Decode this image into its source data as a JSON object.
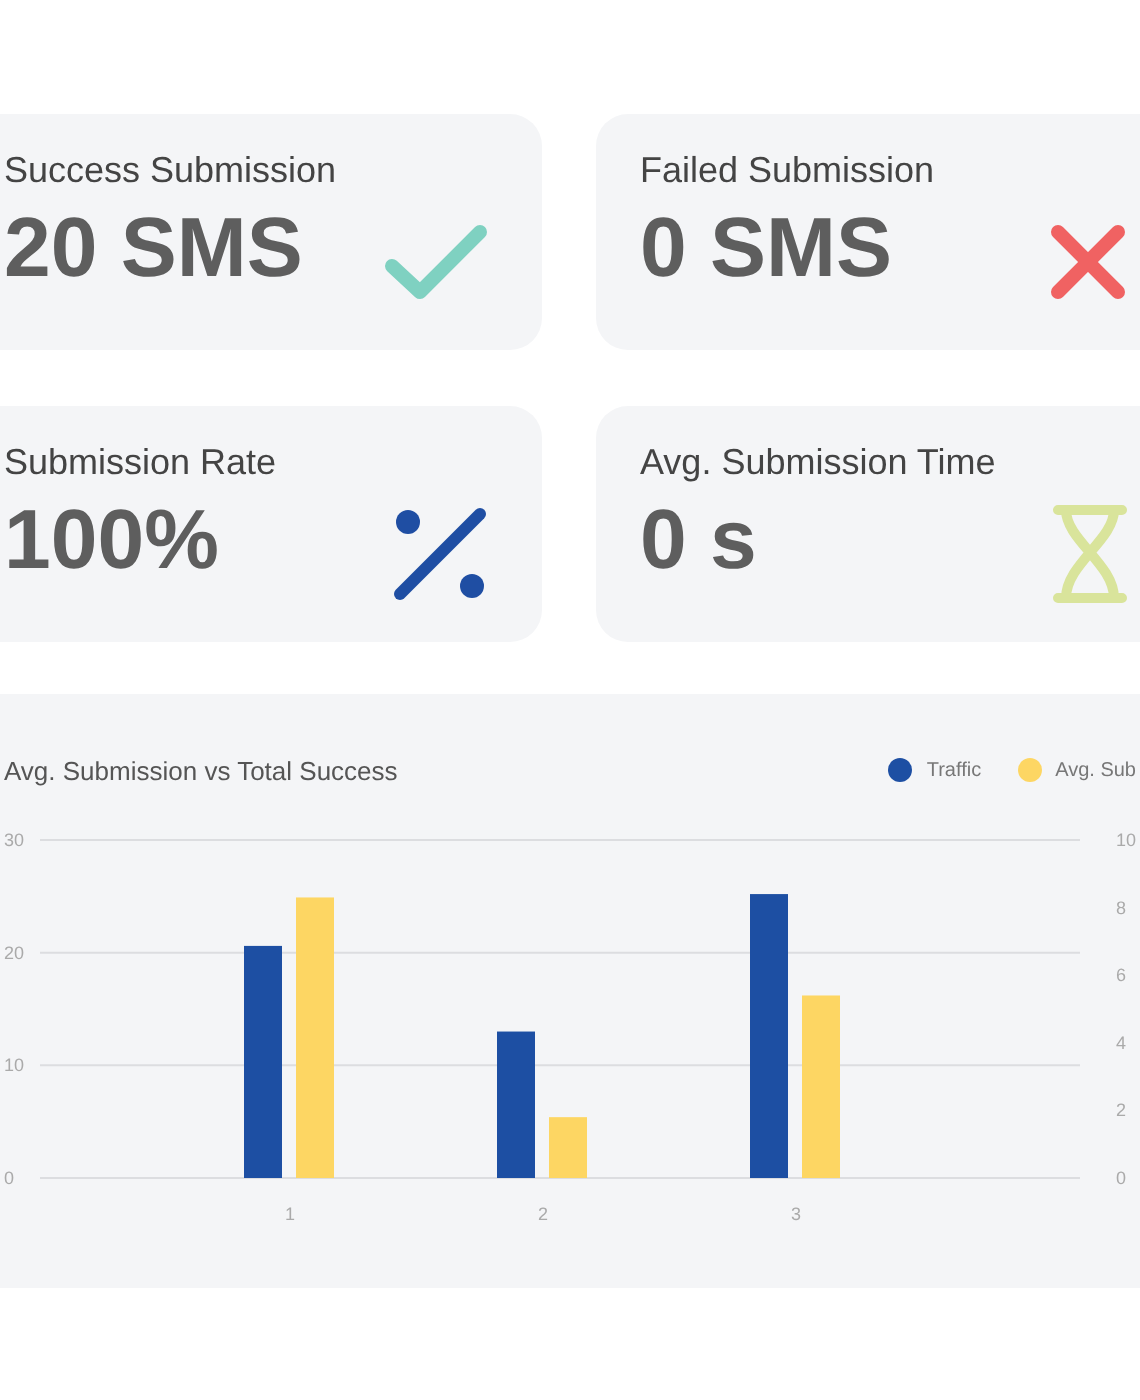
{
  "stats": [
    {
      "label": "Success Submission",
      "value": "20 SMS",
      "kind": "success"
    },
    {
      "label": "Failed Submission",
      "value": "0 SMS",
      "kind": "failed"
    },
    {
      "label": "Submission Rate",
      "value": "100%",
      "kind": "rate"
    },
    {
      "label": "Avg. Submission Time",
      "value": "0 s",
      "kind": "time"
    }
  ],
  "chart": {
    "chart_data": {
      "type": "bar",
      "title": "Avg. Submission vs Total Success",
      "categories": [
        "1",
        "2",
        "3"
      ],
      "series": [
        {
          "name": "Traffic",
          "color": "#1d4fa3",
          "values": [
            20.6,
            13,
            25.2
          ]
        },
        {
          "name": "Avg. Sub",
          "color": "#fdd663",
          "values": [
            8.3,
            1.8,
            5.4
          ],
          "axis": "y2"
        }
      ],
      "ylim": [
        0,
        30
      ],
      "yticks": [
        0,
        10,
        20,
        30
      ],
      "y2lim": [
        0,
        10
      ],
      "y2ticks": [
        0,
        2,
        4,
        6,
        8,
        10
      ]
    }
  }
}
